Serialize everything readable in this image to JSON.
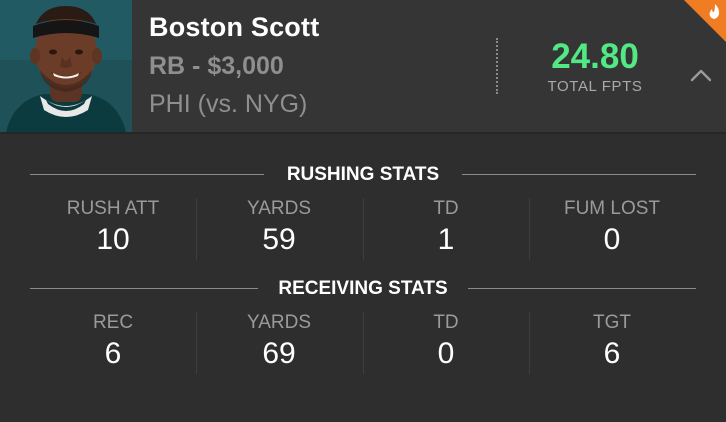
{
  "player": {
    "name": "Boston Scott",
    "position_salary": "RB - $3,000",
    "matchup": "PHI (vs. NYG)",
    "fpts": "24.80",
    "fpts_label": "TOTAL FPTS"
  },
  "colors": {
    "background": "#2e2e2e",
    "header_background": "#353535",
    "fpts_green": "#52e883",
    "hot_badge_orange": "#f07d24",
    "muted_text": "#8f8f8f"
  },
  "icons": {
    "collapse": "chevron-up-icon",
    "hot": "flame-icon"
  },
  "rushing": {
    "title": "RUSHING STATS",
    "stats": [
      {
        "label": "RUSH ATT",
        "value": "10"
      },
      {
        "label": "YARDS",
        "value": "59"
      },
      {
        "label": "TD",
        "value": "1"
      },
      {
        "label": "FUM LOST",
        "value": "0"
      }
    ]
  },
  "receiving": {
    "title": "RECEIVING STATS",
    "stats": [
      {
        "label": "REC",
        "value": "6"
      },
      {
        "label": "YARDS",
        "value": "69"
      },
      {
        "label": "TD",
        "value": "0"
      },
      {
        "label": "TGT",
        "value": "6"
      }
    ]
  }
}
